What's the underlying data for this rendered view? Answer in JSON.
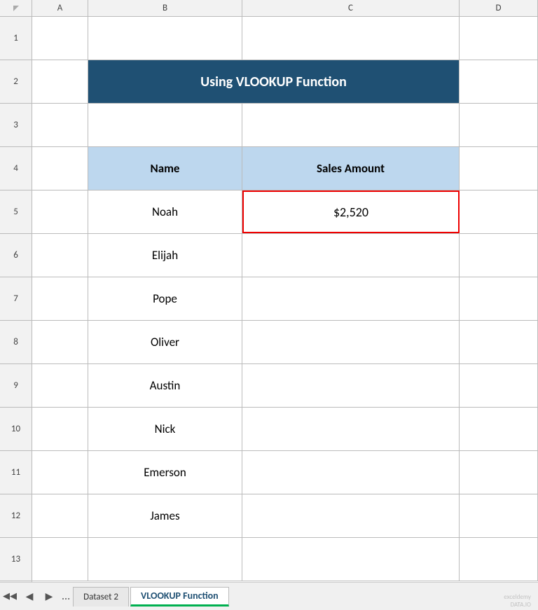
{
  "columns": {
    "headers": [
      "A",
      "B",
      "C",
      "D"
    ]
  },
  "rows": {
    "numbers": [
      "1",
      "2",
      "3",
      "4",
      "5",
      "6",
      "7",
      "8",
      "9",
      "10",
      "11",
      "12",
      "13"
    ],
    "count": 13
  },
  "title": {
    "text": "Using VLOOKUP Function"
  },
  "table": {
    "header_name": "Name",
    "header_sales": "Sales Amount",
    "data": [
      {
        "name": "Noah",
        "sales": "$2,520"
      },
      {
        "name": "Elijah",
        "sales": ""
      },
      {
        "name": "Pope",
        "sales": ""
      },
      {
        "name": "Oliver",
        "sales": ""
      },
      {
        "name": "Austin",
        "sales": ""
      },
      {
        "name": "Nick",
        "sales": ""
      },
      {
        "name": "Emerson",
        "sales": ""
      },
      {
        "name": "James",
        "sales": ""
      }
    ]
  },
  "tabs": {
    "items": [
      "Dataset 2",
      "VLOOKUP Function"
    ]
  },
  "watermark": "exceldemy\nDATA.IO"
}
